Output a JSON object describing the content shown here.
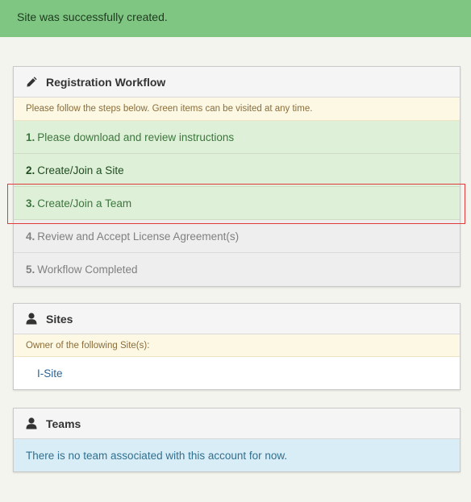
{
  "alert": {
    "message": "Site was successfully created."
  },
  "workflow": {
    "title": "Registration Workflow",
    "icon": "pencil-icon",
    "notice": "Please follow the steps below. Green items can be visited at any time.",
    "steps": [
      {
        "num": "1.",
        "label": "Please download and review instructions",
        "status": "green"
      },
      {
        "num": "2.",
        "label": "Create/Join a Site",
        "status": "green"
      },
      {
        "num": "3.",
        "label": "Create/Join a Team",
        "status": "green"
      },
      {
        "num": "4.",
        "label": "Review and Accept License Agreement(s)",
        "status": "grey"
      },
      {
        "num": "5.",
        "label": "Workflow Completed",
        "status": "grey"
      }
    ]
  },
  "sites": {
    "title": "Sites",
    "icon": "user-icon",
    "notice": "Owner of the following Site(s):",
    "items": [
      {
        "label": "I-Site"
      }
    ]
  },
  "teams": {
    "title": "Teams",
    "icon": "user-icon",
    "info": "There is no team associated with this account for now."
  },
  "colors": {
    "alert_bg": "#7fc683",
    "step_green_bg": "#dff0d8",
    "step_grey_bg": "#eeeeee",
    "notice_bg": "#fcf8e3",
    "info_bg": "#d9edf7",
    "highlight": "#e03a3a",
    "link": "#2a6496"
  }
}
